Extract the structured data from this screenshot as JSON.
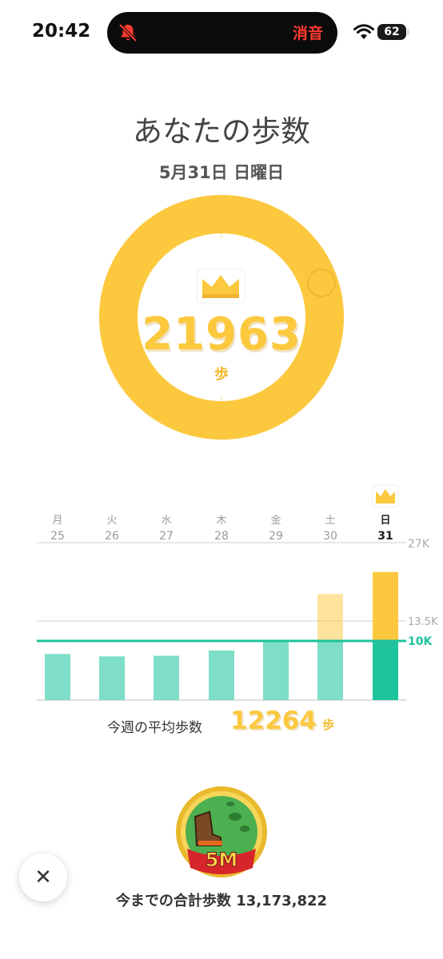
{
  "status_bar": {
    "time": "20:42",
    "mute_label": "消音",
    "battery": "62"
  },
  "title": "あなたの歩数",
  "date": "5月31日 日曜日",
  "today": {
    "steps": "21963",
    "unit": "歩",
    "goal_progress": 1.0
  },
  "week": {
    "days": [
      {
        "name": "月",
        "date": "25"
      },
      {
        "name": "火",
        "date": "26"
      },
      {
        "name": "水",
        "date": "27"
      },
      {
        "name": "木",
        "date": "28"
      },
      {
        "name": "金",
        "date": "29"
      },
      {
        "name": "土",
        "date": "30"
      },
      {
        "name": "日",
        "date": "31"
      }
    ],
    "y_labels": {
      "top": "27K",
      "mid": "13.5K",
      "goal": "10K"
    },
    "average_label": "今週の平均歩数",
    "average_value": "12264",
    "average_unit": "歩"
  },
  "chart_data": {
    "type": "bar",
    "categories": [
      "25",
      "26",
      "27",
      "28",
      "29",
      "30",
      "31"
    ],
    "values": [
      7900,
      7500,
      7600,
      8500,
      10300,
      18200,
      21963
    ],
    "goal": 10000,
    "ylim": [
      0,
      27000
    ],
    "tick_labels": [
      "27K",
      "13.5K",
      "10K"
    ],
    "colors": {
      "below_goal": "#7fdec8",
      "above_goal": "#fcc83d",
      "goal_line": "#1fc39c"
    }
  },
  "total": {
    "label": "今までの合計歩数",
    "value": "13,173,822"
  },
  "medal": {
    "label": "5M"
  },
  "colors": {
    "accent": "#fcc83d",
    "goal": "#1fc39c",
    "mute": "#ff3b30"
  }
}
